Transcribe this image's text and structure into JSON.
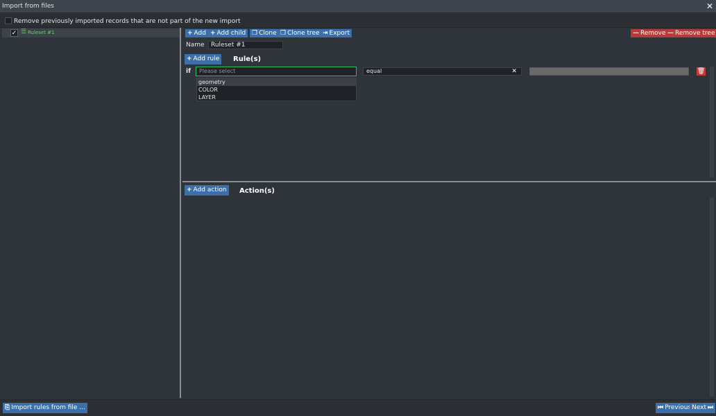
{
  "window": {
    "title": "Import from files",
    "close_glyph": "✕"
  },
  "options": {
    "remove_previous_label": "Remove previously imported records that are not part of the new import"
  },
  "tree": {
    "items": [
      {
        "label": "Ruleset #1",
        "check_glyph": "✓",
        "icon": "list-icon",
        "icon_glyph": "☰"
      }
    ]
  },
  "toolbar": {
    "add": "Add",
    "add_child": "Add child",
    "clone": "Clone",
    "clone_tree": "Clone tree",
    "export": "Export",
    "remove": "Remove",
    "remove_tree": "Remove tree",
    "plus_glyph": "+",
    "minus_glyph": "—",
    "clone_glyph": "❐",
    "export_glyph": "⇥"
  },
  "ruleset": {
    "name_label": "Name",
    "name_value": "Ruleset #1"
  },
  "rules": {
    "add_label": "Add rule",
    "section_title": "Rule(s)",
    "if_label": "if",
    "field_placeholder": "Please select",
    "field_options": [
      "geometry",
      "COLOR",
      "LAYER"
    ],
    "operator_value": "equal",
    "clear_glyph": "✕",
    "delete_glyph": "🗑"
  },
  "actions": {
    "add_label": "Add action",
    "section_title": "Action(s)"
  },
  "footer": {
    "import_label": "Import rules from file ...",
    "import_glyph": "⎘",
    "previous_label": "Previous",
    "previous_glyph": "⏮",
    "next_label": "Next",
    "next_glyph": "⏭"
  },
  "colors": {
    "accent_blue": "#3c6ea8",
    "danger_red": "#b83b3b",
    "tree_green": "#6ccd6c",
    "focus_green": "#2fbf5a"
  }
}
